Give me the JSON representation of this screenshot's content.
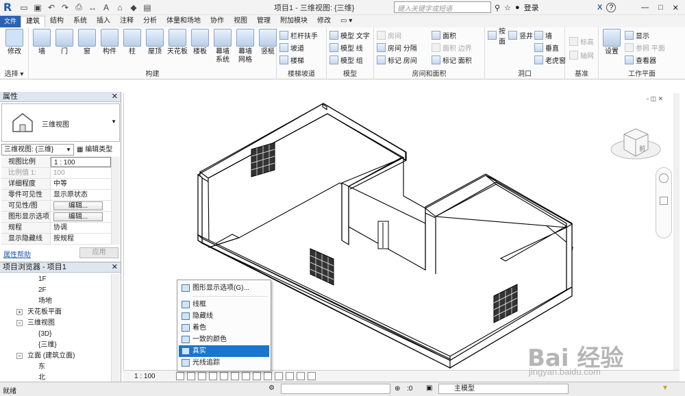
{
  "titlebar": {
    "title": "项目1 - 三维视图: {三维}",
    "search_placeholder": "键入关键字或短语",
    "login": "登录",
    "help": "?"
  },
  "tabs": [
    "文件",
    "建筑",
    "结构",
    "系统",
    "插入",
    "注释",
    "分析",
    "体量和场地",
    "协作",
    "视图",
    "管理",
    "附加模块",
    "修改"
  ],
  "active_tab": "建筑",
  "ribbon": {
    "select_group": {
      "modify": "修改",
      "label": "选择"
    },
    "build_group": {
      "label": "构建",
      "buttons": [
        "墙",
        "门",
        "窗",
        "构件",
        "柱",
        "屋顶",
        "天花板",
        "楼板",
        "幕墙\n系统",
        "幕墙\n网格",
        "竖梃"
      ]
    },
    "stairs_group": {
      "label": "楼梯坡道",
      "items": [
        "栏杆扶手",
        "坡道",
        "楼梯"
      ]
    },
    "model_group": {
      "label": "模型",
      "items": [
        "模型 文字",
        "模型 线",
        "模型 组"
      ]
    },
    "room_group": {
      "label": "房间和面积",
      "items": [
        "房间",
        "房间 分隔",
        "标记 房间",
        "面积",
        "面积 边界",
        "标记 面积"
      ]
    },
    "opening_group": {
      "label": "洞口",
      "items": [
        "按\n面",
        "竖井",
        "墙",
        "垂直",
        "老虎窗"
      ]
    },
    "datum_group": {
      "label": "基准",
      "items": [
        "标高",
        "轴网"
      ]
    },
    "workplane_group": {
      "label": "工作平面",
      "items": [
        "设置",
        "显示",
        "参照 平面",
        "查看器"
      ]
    }
  },
  "properties": {
    "header": "属性",
    "type_name": "三维视图",
    "selector_value": "三维视图: {三维}",
    "edit_type": "编辑类型",
    "rows": [
      {
        "k": "视图比例",
        "v": "1 : 100",
        "dim": false
      },
      {
        "k": "比例值 1:",
        "v": "100",
        "dim": true
      },
      {
        "k": "详细程度",
        "v": "中等",
        "dim": false
      },
      {
        "k": "零件可见性",
        "v": "显示原状态",
        "dim": false
      },
      {
        "k": "可见性/图形...",
        "v": "编辑...",
        "dim": false,
        "btn": true
      },
      {
        "k": "图形显示选项",
        "v": "编辑...",
        "dim": false,
        "btn": true
      },
      {
        "k": "规程",
        "v": "协调",
        "dim": false
      },
      {
        "k": "显示隐藏线",
        "v": "按规程",
        "dim": false
      }
    ],
    "help_link": "属性帮助",
    "apply": "应用"
  },
  "browser": {
    "header": "项目浏览器 - 项目1",
    "items": [
      {
        "label": "1F",
        "indent": 56,
        "exp": ""
      },
      {
        "label": "2F",
        "indent": 56,
        "exp": ""
      },
      {
        "label": "场地",
        "indent": 56,
        "exp": ""
      },
      {
        "label": "天花板平面",
        "indent": 40,
        "exp": "+"
      },
      {
        "label": "三维视图",
        "indent": 40,
        "exp": "−"
      },
      {
        "label": "{3D}",
        "indent": 56,
        "exp": ""
      },
      {
        "label": "{三维}",
        "indent": 56,
        "exp": ""
      },
      {
        "label": "立面 (建筑立面)",
        "indent": 40,
        "exp": "−"
      },
      {
        "label": "东",
        "indent": 56,
        "exp": ""
      },
      {
        "label": "北",
        "indent": 56,
        "exp": ""
      }
    ]
  },
  "context_menu": {
    "items": [
      {
        "label": "图形显示选项(G)...",
        "selected": false
      },
      {
        "label": "线框",
        "selected": false
      },
      {
        "label": "隐藏线",
        "selected": false
      },
      {
        "label": "着色",
        "selected": false
      },
      {
        "label": "一致的颜色",
        "selected": false
      },
      {
        "label": "真实",
        "selected": true
      },
      {
        "label": "光线追踪",
        "selected": false
      }
    ]
  },
  "viewbar": {
    "scale": "1 : 100"
  },
  "status": {
    "ready": "就绪",
    "zero": ":0",
    "model": "主模型"
  },
  "watermark": {
    "brand": "Bai 经验",
    "url": "jingyan.baidu.com"
  },
  "viewcube": {
    "face": "前"
  },
  "colors": {
    "accent": "#1a75cf",
    "ribbon_bg": "#fbfbfb",
    "file_tab": "#2b62b5"
  }
}
